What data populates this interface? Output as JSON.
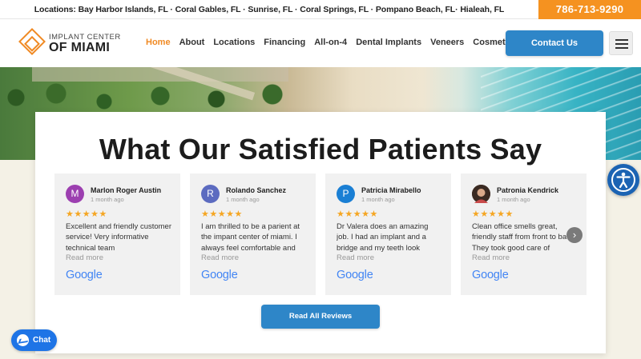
{
  "topbar": {
    "locations": "Locations: Bay Harbor Islands, FL · Coral Gables, FL · Sunrise, FL · Coral Springs, FL · Pompano Beach, FL· Hialeah, FL",
    "phone": "786-713-9290"
  },
  "header": {
    "logo_line1": "IMPLANT CENTER",
    "logo_line2": "OF MIAMI",
    "nav": [
      "Home",
      "About",
      "Locations",
      "Financing",
      "All-on-4",
      "Dental Implants",
      "Veneers",
      "Cosmetic"
    ],
    "active_nav": "Home",
    "contact_label": "Contact Us",
    "menu_icon": "hamburger-icon"
  },
  "section": {
    "title": "What Our Satisfied Patients Say",
    "read_all_label": "Read All Reviews",
    "next_arrow": "›"
  },
  "reviews": [
    {
      "initial": "M",
      "avatar_color": "#9c3fb0",
      "name": "Marlon Roger Austin",
      "time": "1 month ago",
      "stars": "★★★★★",
      "text": "Excellent and friendly customer service! Very informative technical team",
      "more": "Read more",
      "source": "Google"
    },
    {
      "initial": "R",
      "avatar_color": "#5c6bc0",
      "name": "Rolando Sanchez",
      "time": "1 month ago",
      "stars": "★★★★★",
      "text": "I am thrilled to be a parient at the impant center of miami. I always feel comfortable and",
      "more": "Read more",
      "source": "Google"
    },
    {
      "initial": "P",
      "avatar_color": "#1a7fd4",
      "name": "Patricia Mirabello",
      "time": "1 month ago",
      "stars": "★★★★★",
      "text": "Dr Valera does an amazing job. I had an implant and a bridge and my teeth look",
      "more": "Read more",
      "source": "Google"
    },
    {
      "initial": "",
      "avatar_color": "#6b4a3a",
      "name": "Patronia Kendrick",
      "time": "1 month ago",
      "stars": "★★★★★",
      "text": "Clean office smells great, friendly staff from front to back. They took good care of",
      "more": "Read more",
      "source": "Google"
    }
  ],
  "widgets": {
    "accessibility_icon": "accessibility-icon",
    "chat_label": "Chat",
    "chat_icon": "messenger-icon"
  }
}
